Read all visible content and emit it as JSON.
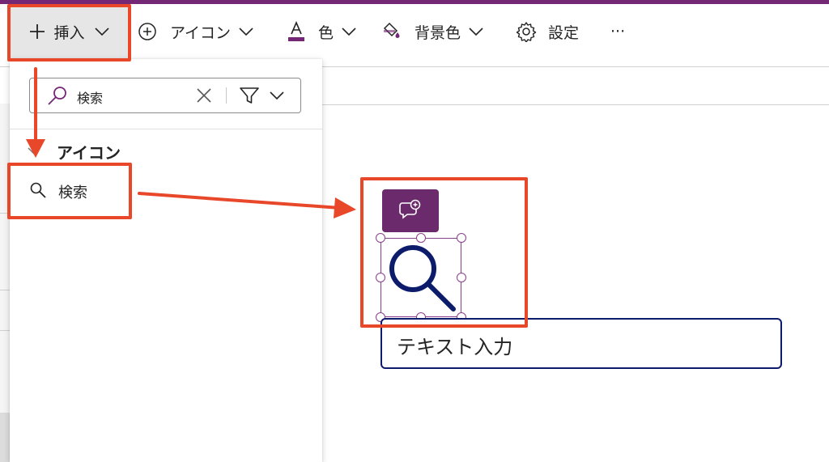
{
  "toolbar": {
    "insert_label": "挿入",
    "icon_label": "アイコン",
    "color_label": "色",
    "bg_color_label": "背景色",
    "settings_label": "設定",
    "more_label": "···"
  },
  "insert_panel": {
    "search_value": "検索",
    "group_label": "アイコン",
    "result_label": "検索"
  },
  "canvas": {
    "text_input_value": "テキスト入力"
  },
  "colors": {
    "brand_purple": "#742774",
    "annotation_red": "#e8472a",
    "navy": "#0d1b6b"
  }
}
